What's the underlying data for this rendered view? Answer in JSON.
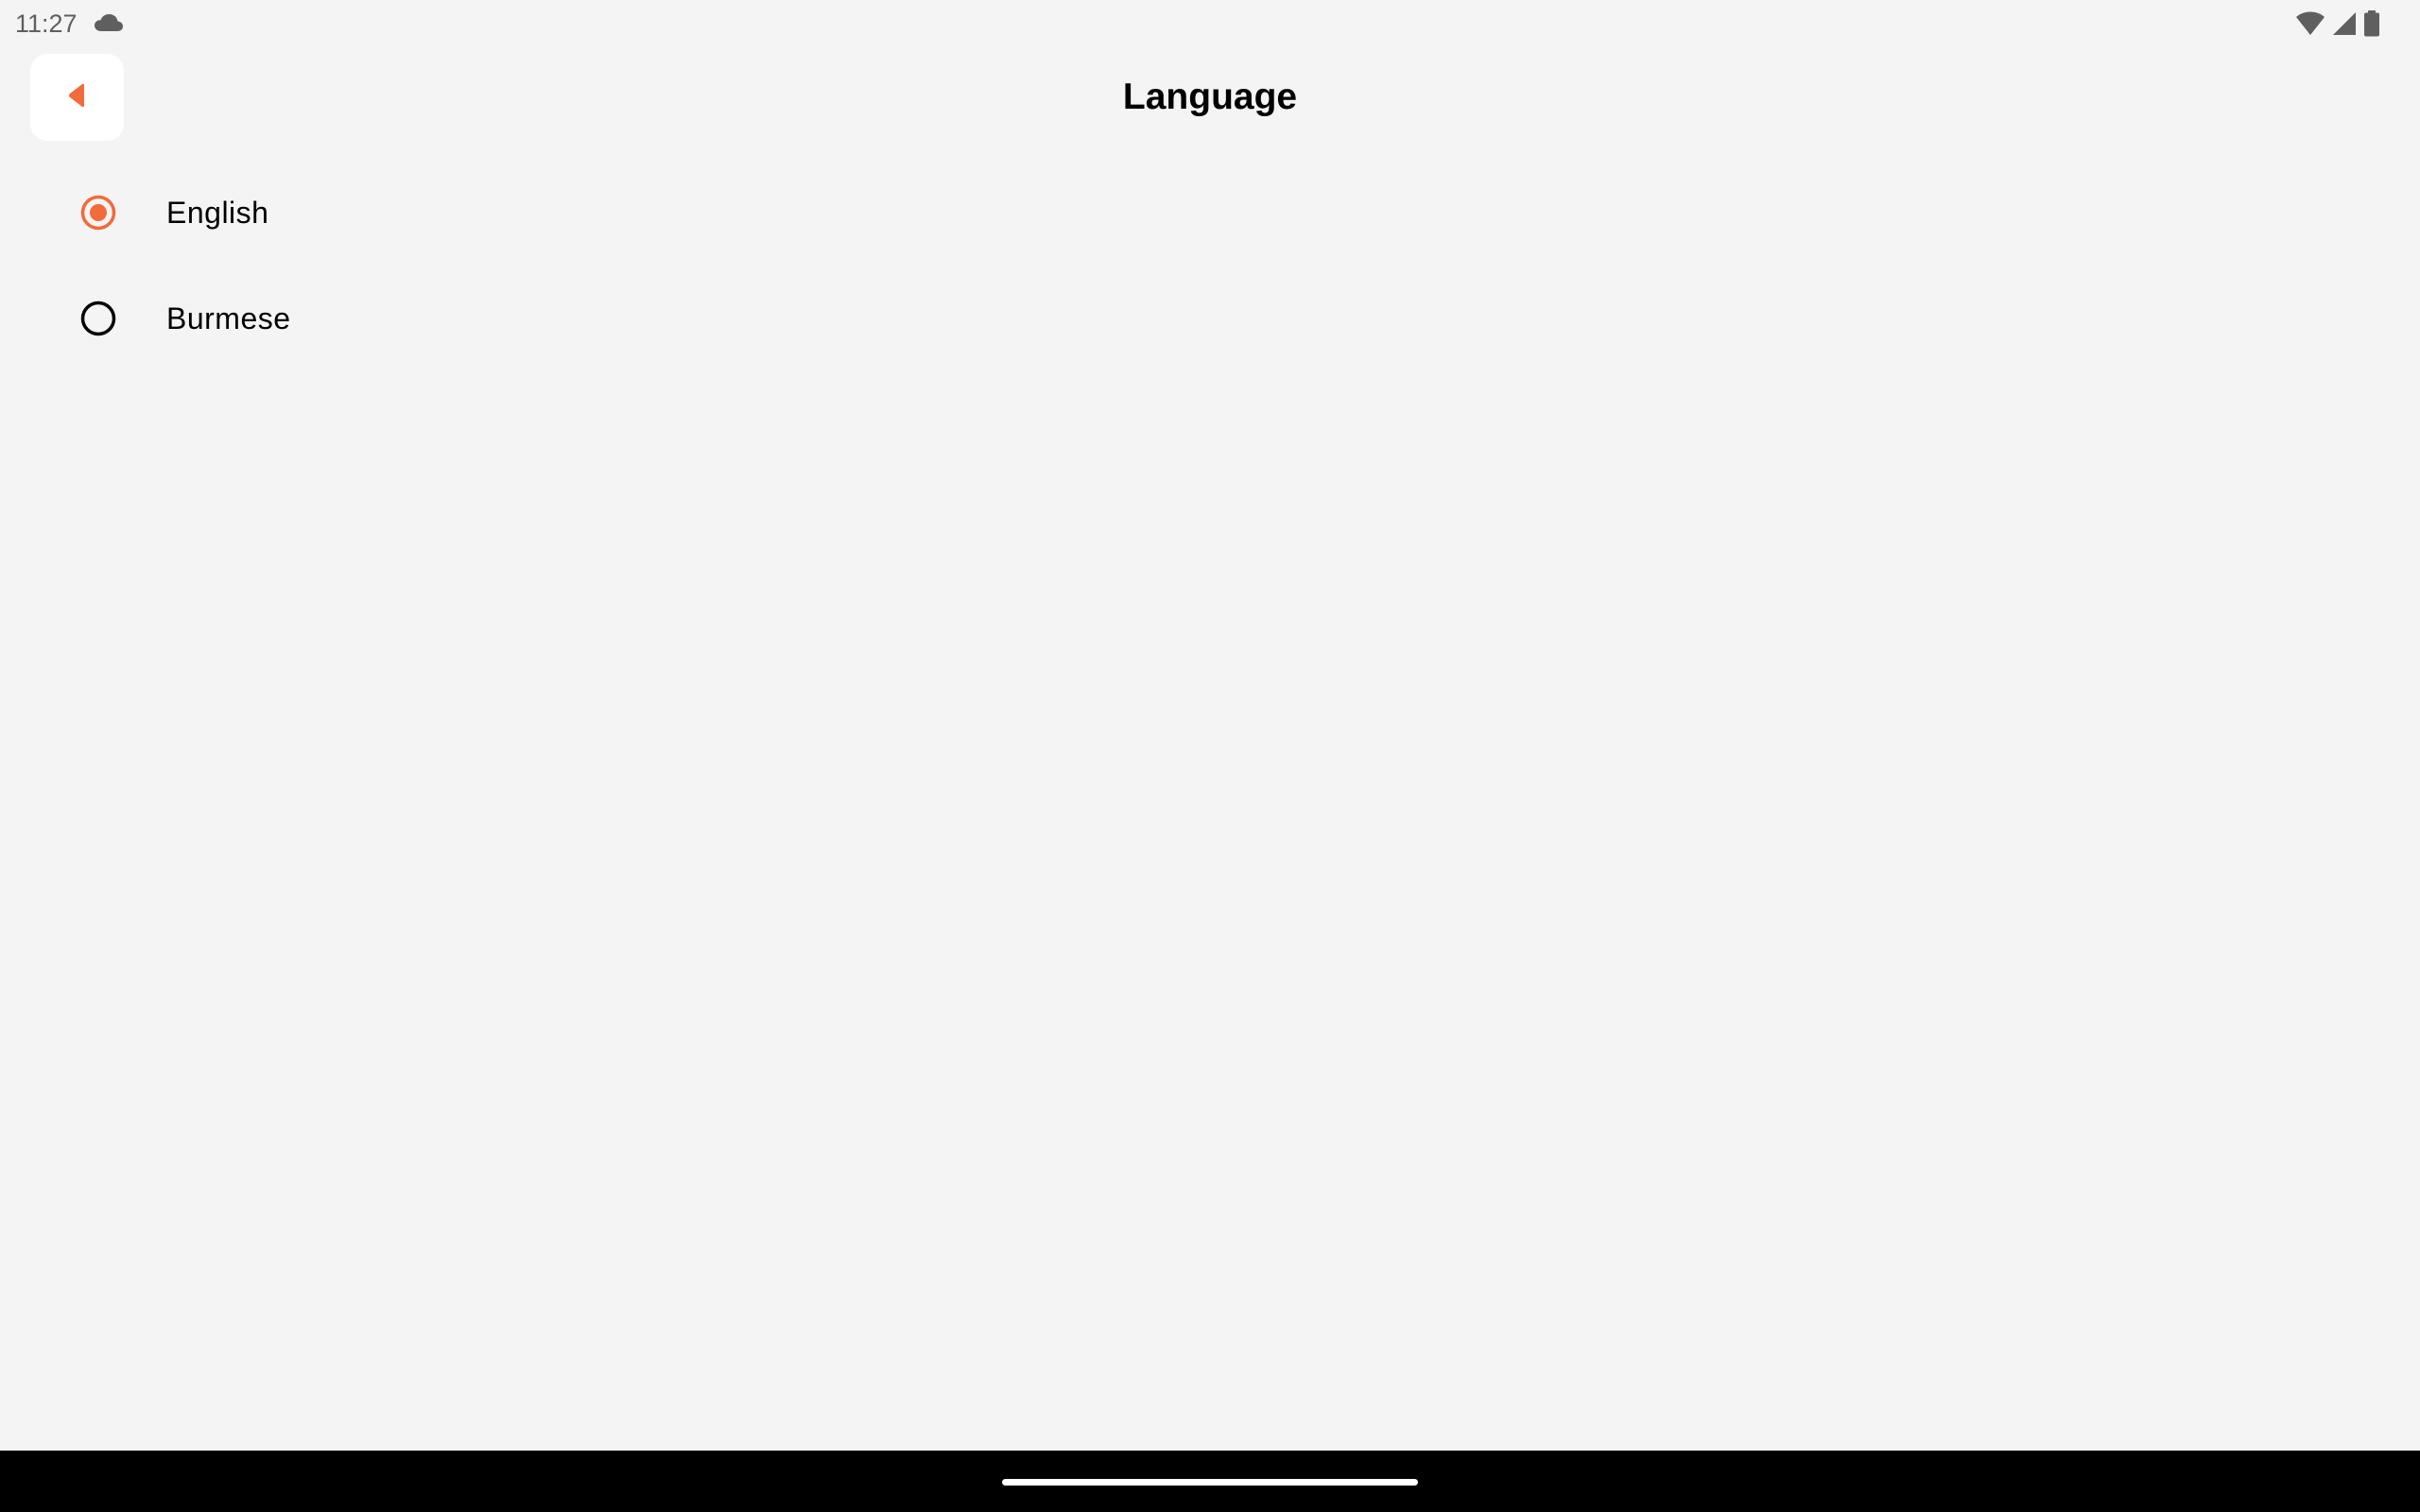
{
  "status_bar": {
    "time": "11:27",
    "left_icons": [
      "cloud-icon"
    ],
    "right_icons": [
      "wifi-icon",
      "cellular-signal-icon",
      "battery-icon"
    ]
  },
  "header": {
    "title": "Language",
    "back_icon": "back-arrow-icon"
  },
  "languages": {
    "options": [
      {
        "label": "English",
        "selected": true
      },
      {
        "label": "Burmese",
        "selected": false
      }
    ]
  },
  "colors": {
    "accent": "#f26b3a",
    "background": "#f4f4f4",
    "nav_bar": "#000000"
  }
}
